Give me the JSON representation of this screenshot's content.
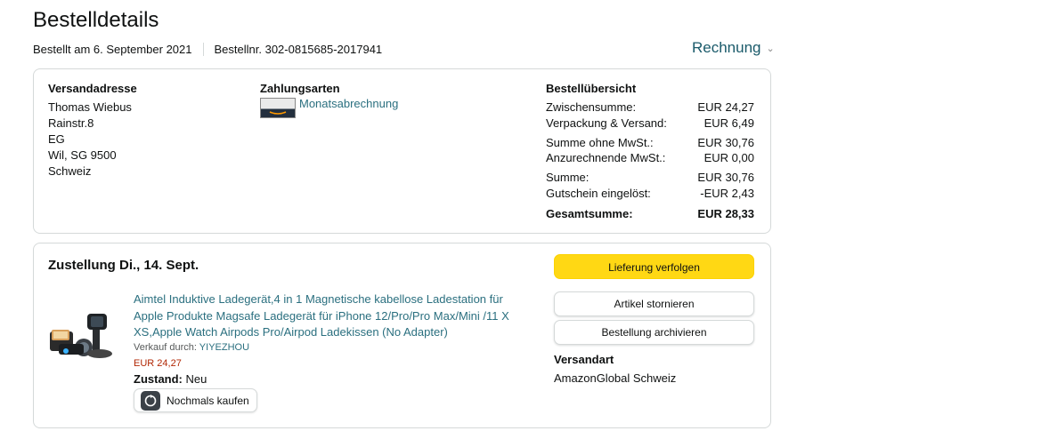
{
  "header": {
    "title": "Bestelldetails",
    "order_date": "Bestellt am 6. September 2021",
    "order_number": "Bestellnr. 302-0815685-2017941",
    "invoice_label": "Rechnung"
  },
  "shipping_address": {
    "heading": "Versandadresse",
    "lines": [
      "Thomas Wiebus",
      "Rainstr.8",
      "EG",
      "Wil, SG 9500",
      "Schweiz"
    ]
  },
  "payment": {
    "heading": "Zahlungsarten",
    "method": "Monatsabrechnung"
  },
  "summary": {
    "heading": "Bestellübersicht",
    "rows": [
      {
        "label": "Zwischensumme:",
        "value": "EUR 24,27"
      },
      {
        "label": "Verpackung & Versand:",
        "value": "EUR 6,49"
      },
      {
        "label": "Summe ohne MwSt.:",
        "value": "EUR 30,76"
      },
      {
        "label": "Anzurechnende MwSt.:",
        "value": "EUR 0,00"
      },
      {
        "label": "Summe:",
        "value": "EUR 30,76"
      },
      {
        "label": "Gutschein eingelöst:",
        "value": "-EUR 2,43"
      }
    ],
    "total": {
      "label": "Gesamtsumme:",
      "value": "EUR 28,33"
    }
  },
  "delivery": {
    "heading": "Zustellung Di., 14. Sept.",
    "product_title": "Aimtel Induktive Ladegerät,4 in 1 Magnetische kabellose Ladestation für Apple Produkte Magsafe Ladegerät für iPhone 12/Pro/Pro Max/Mini /11 X XS,Apple Watch Airpods Pro/Airpod Ladekissen (No Adapter)",
    "sold_by_label": "Verkauf durch:",
    "seller": "YIYEZHOU",
    "price": "EUR 24,27",
    "condition_label": "Zustand:",
    "condition": "Neu",
    "rebuy_label": "Nochmals kaufen",
    "track_button": "Lieferung verfolgen",
    "cancel_button": "Artikel stornieren",
    "archive_button": "Bestellung archivieren",
    "shipping_type_heading": "Versandart",
    "shipping_type": "AmazonGlobal Schweiz"
  }
}
